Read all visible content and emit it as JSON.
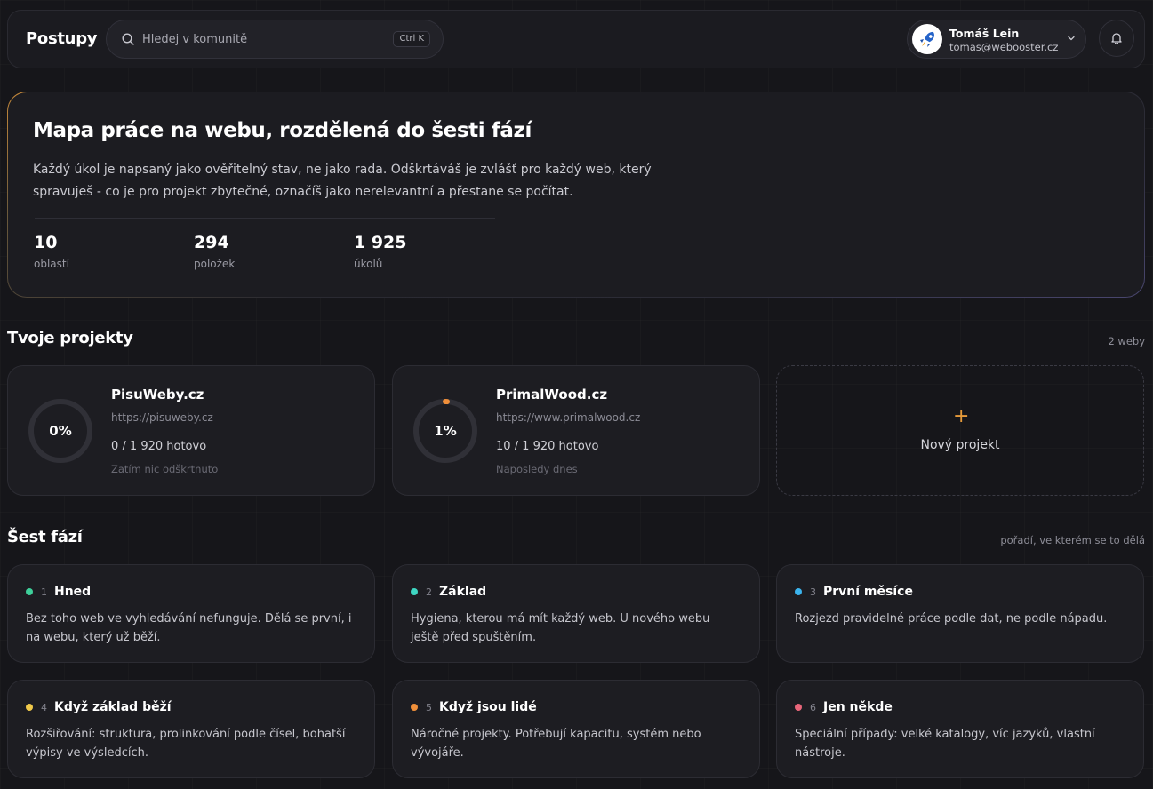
{
  "header": {
    "brand": "Postupy",
    "search_placeholder": "Hledej v komunitě",
    "search_shortcut": "Ctrl K",
    "user_name": "Tomáš Lein",
    "user_email": "tomas@webooster.cz"
  },
  "hero": {
    "title": "Mapa práce na webu, rozdělená do šesti fází",
    "description": "Každý úkol je napsaný jako ověřitelný stav, ne jako rada. Odškrtáváš je zvlášť pro každý web, který spravuješ - co je pro projekt zbytečné, označíš jako nerelevantní a přestane se počítat.",
    "stats": [
      {
        "value": "10",
        "label": "oblastí"
      },
      {
        "value": "294",
        "label": "položek"
      },
      {
        "value": "1 925",
        "label": "úkolů"
      }
    ]
  },
  "projects": {
    "title": "Tvoje projekty",
    "meta": "2 weby",
    "items": [
      {
        "name": "PisuWeby.cz",
        "url": "https://pisuweby.cz",
        "percent_label": "0%",
        "percent": 0,
        "progress": "0 / 1 920 hotovo",
        "note": "Zatím nic odškrtnuto"
      },
      {
        "name": "PrimalWood.cz",
        "url": "https://www.primalwood.cz",
        "percent_label": "1%",
        "percent": 1,
        "progress": "10 / 1 920 hotovo",
        "note": "Naposledy dnes"
      }
    ],
    "new_label": "Nový projekt"
  },
  "phases": {
    "title": "Šest fází",
    "meta": "pořadí, ve kterém se to dělá",
    "items": [
      {
        "num": "1",
        "name": "Hned",
        "desc": "Bez toho web ve vyhledávání nefunguje. Dělá se první, i na webu, který už běží.",
        "color": "#3ecf9a"
      },
      {
        "num": "2",
        "name": "Základ",
        "desc": "Hygiena, kterou má mít každý web. U nového webu ještě před spuštěním.",
        "color": "#3ed6c2"
      },
      {
        "num": "3",
        "name": "První měsíce",
        "desc": "Rozjezd pravidelné práce podle dat, ne podle nápadu.",
        "color": "#3bb4ee"
      },
      {
        "num": "4",
        "name": "Když základ běží",
        "desc": "Rozšiřování: struktura, prolinkování podle čísel, bohatší výpisy ve výsledcích.",
        "color": "#f0c94a"
      },
      {
        "num": "5",
        "name": "Když jsou lidé",
        "desc": "Náročné projekty. Potřebují kapacitu, systém nebo vývojáře.",
        "color": "#f08f3a"
      },
      {
        "num": "6",
        "name": "Jen někde",
        "desc": "Speciální případy: velké katalogy, víc jazyků, vlastní nástroje.",
        "color": "#e8667a"
      }
    ]
  }
}
